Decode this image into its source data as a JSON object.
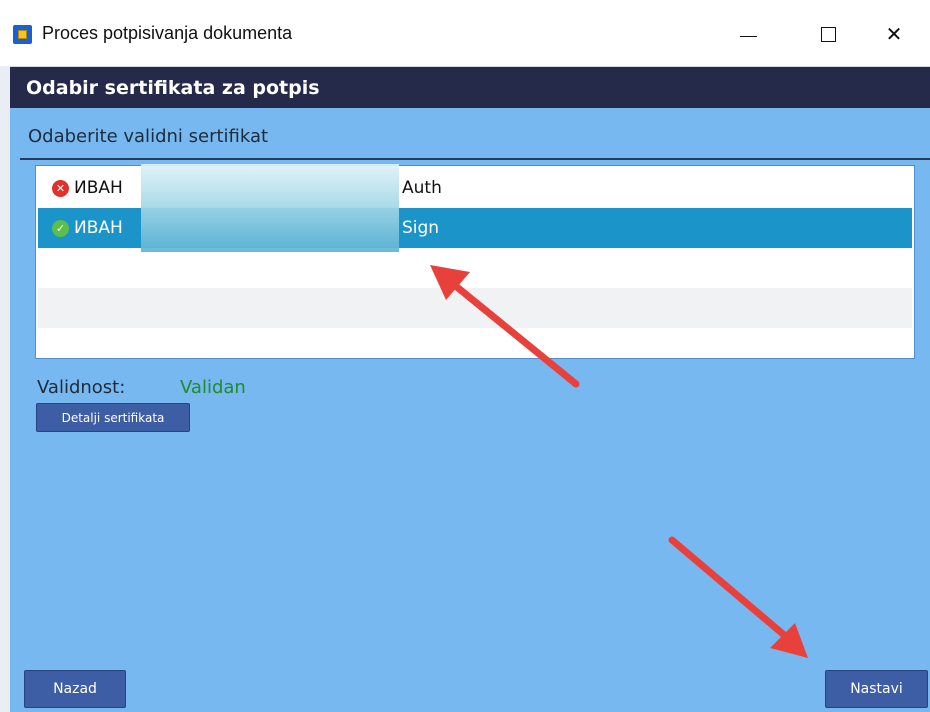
{
  "window": {
    "title": "Proces potpisivanja dokumenta",
    "minimize_glyph": "—",
    "close_glyph": "✕"
  },
  "header": {
    "title": "Odabir sertifikata za potpis"
  },
  "subheading": "Odaberite validni sertifikat",
  "certificates": [
    {
      "name": "ИВАН",
      "type": "Auth",
      "status_icon": "error-icon",
      "status_glyph": "✕"
    },
    {
      "name": "ИВАН",
      "type": "Sign",
      "status_icon": "check-icon",
      "status_glyph": "✓",
      "selected": true
    }
  ],
  "validity": {
    "label": "Validnost:",
    "value": "Validan"
  },
  "buttons": {
    "details": "Detalji sertifikata",
    "back": "Nazad",
    "next": "Nastavi"
  },
  "colors": {
    "background": "#78b8f0",
    "header_band": "#25294a",
    "selected_row": "#1b95c9",
    "button": "#3d5ea4",
    "valid_text": "#1f8a2e",
    "arrow": "#e8413c"
  }
}
